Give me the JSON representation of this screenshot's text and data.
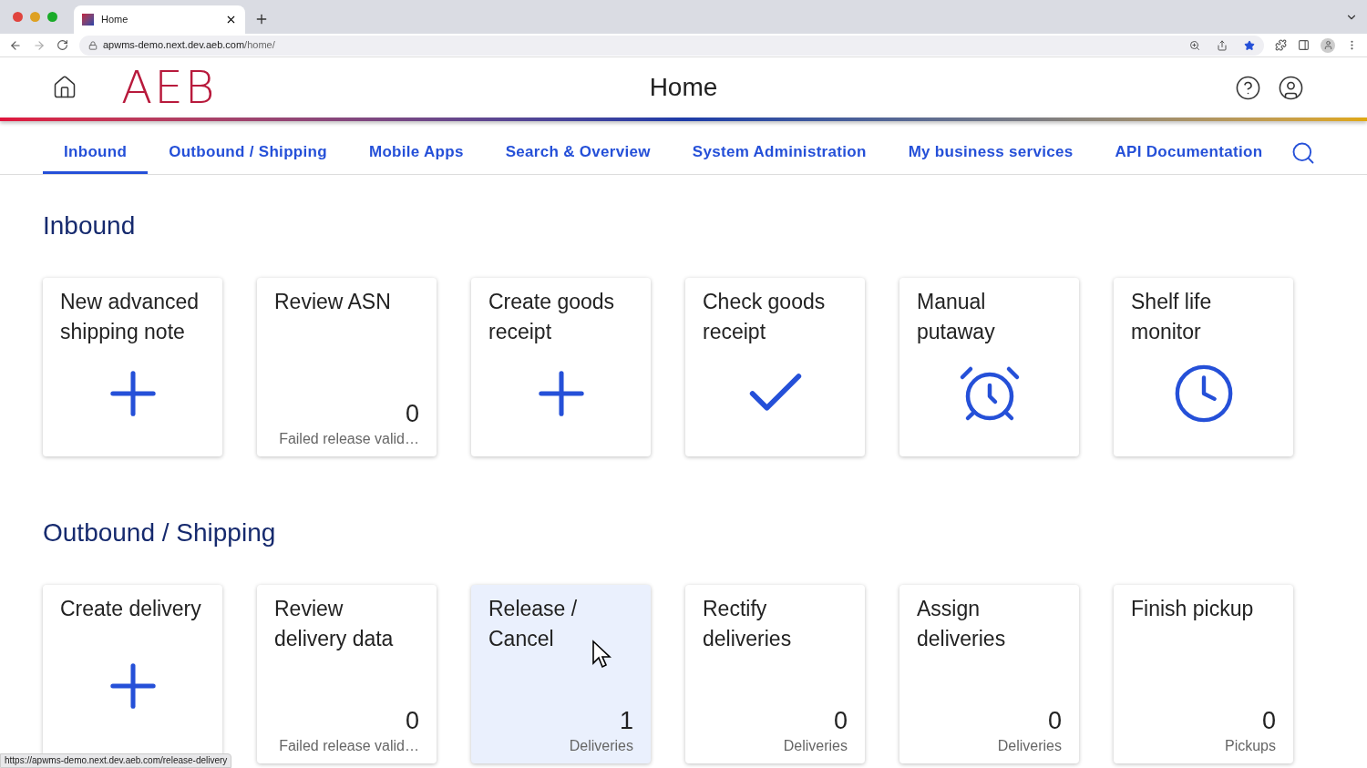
{
  "browser": {
    "tab_title": "Home",
    "url_host": "apwms-demo.next.dev.aeb.com",
    "url_path": "/home/",
    "status_url": "https://apwms-demo.next.dev.aeb.com/release-delivery"
  },
  "header": {
    "logo": "AEB",
    "title": "Home"
  },
  "nav": [
    {
      "label": "Inbound",
      "selected": true
    },
    {
      "label": "Outbound / Shipping",
      "selected": false
    },
    {
      "label": "Mobile Apps",
      "selected": false
    },
    {
      "label": "Search & Overview",
      "selected": false
    },
    {
      "label": "System Administration",
      "selected": false
    },
    {
      "label": "My business services",
      "selected": false
    },
    {
      "label": "API Documentation",
      "selected": false
    }
  ],
  "sections": [
    {
      "title": "Inbound",
      "tiles": [
        {
          "title": "New advanced shipping note",
          "kind": "plus",
          "highlighted": false
        },
        {
          "title": "Review ASN",
          "kind": "count",
          "count": "0",
          "caption": "Failed release valid…",
          "highlighted": false
        },
        {
          "title": "Create goods receipt",
          "kind": "plus",
          "highlighted": false
        },
        {
          "title": "Check goods receipt",
          "kind": "check",
          "highlighted": false
        },
        {
          "title": "Manual putaway",
          "kind": "alarm",
          "highlighted": false
        },
        {
          "title": "Shelf life monitor",
          "kind": "clock",
          "highlighted": false
        }
      ]
    },
    {
      "title": "Outbound / Shipping",
      "tiles": [
        {
          "title": "Create delivery",
          "kind": "plus",
          "highlighted": false
        },
        {
          "title": "Review delivery data",
          "kind": "count",
          "count": "0",
          "caption": "Failed release valid…",
          "highlighted": false
        },
        {
          "title": "Release / Cancel",
          "kind": "count",
          "count": "1",
          "caption": "Deliveries",
          "highlighted": true
        },
        {
          "title": "Rectify deliveries",
          "kind": "count",
          "count": "0",
          "caption": "Deliveries",
          "highlighted": false
        },
        {
          "title": "Assign deliveries",
          "kind": "count",
          "count": "0",
          "caption": "Deliveries",
          "highlighted": false
        },
        {
          "title": "Finish pickup",
          "kind": "count",
          "count": "0",
          "caption": "Pickups",
          "highlighted": false
        }
      ]
    }
  ]
}
